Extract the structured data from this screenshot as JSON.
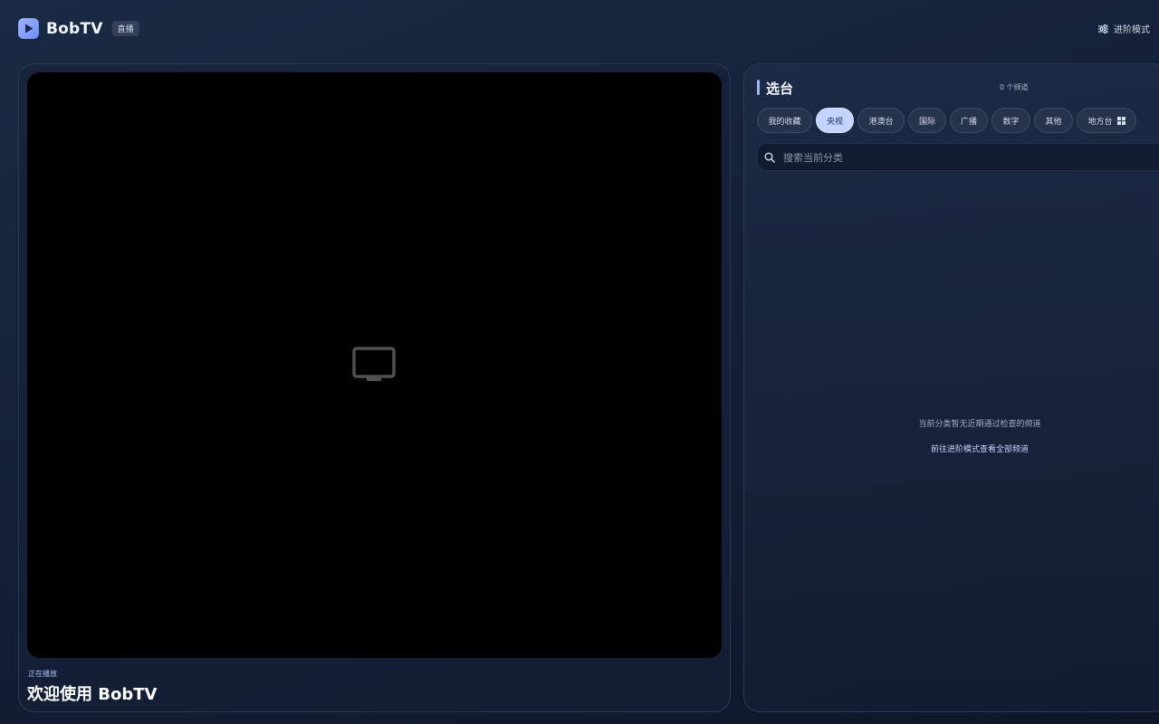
{
  "header": {
    "brand_name": "BobTV",
    "brand_badge": "直播",
    "advanced_mode_label": "进阶模式",
    "icons": {
      "brand": "play-icon",
      "advanced": "sliders-icon"
    }
  },
  "player": {
    "placeholder_icon": "tv-icon",
    "now_playing_label": "正在播放",
    "now_playing_title": "欢迎使用 BobTV"
  },
  "channel_panel": {
    "title": "选台",
    "channel_count": "0 个频道",
    "tabs": [
      {
        "label": "我的收藏",
        "active": false
      },
      {
        "label": "央视",
        "active": true
      },
      {
        "label": "港澳台",
        "active": false
      },
      {
        "label": "国际",
        "active": false
      },
      {
        "label": "广播",
        "active": false
      },
      {
        "label": "数字",
        "active": false
      },
      {
        "label": "其他",
        "active": false
      },
      {
        "label": "地方台",
        "active": false,
        "icon": "grid-icon"
      }
    ],
    "search": {
      "placeholder": "搜索当前分类",
      "value": "",
      "icon": "search-icon"
    },
    "empty_message": "当前分类暂无近期通过检查的频道",
    "empty_link": "前往进阶模式查看全部频道"
  },
  "colors": {
    "accent": "#c4d3ff",
    "brand": "#7f9cf7",
    "background": "#14203a",
    "video_bg": "#000000"
  }
}
